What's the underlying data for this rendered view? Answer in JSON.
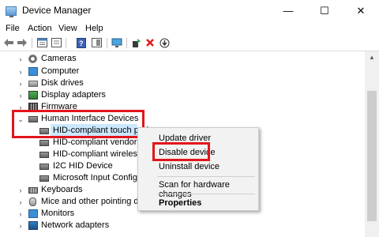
{
  "window": {
    "title": "Device Manager",
    "controls": {
      "minimize": "—",
      "maximize": "☐",
      "close": "✕"
    }
  },
  "menu": [
    "File",
    "Action",
    "View",
    "Help"
  ],
  "toolbar": {
    "icons": [
      "back-icon",
      "forward-icon",
      "properties-icon",
      "help-icon",
      "view-icon",
      "scan-icon",
      "update-driver-icon",
      "uninstall-icon",
      "download-icon"
    ]
  },
  "tree": {
    "rows": [
      {
        "label": "Cameras",
        "expander": "›",
        "icon": "camera-icon"
      },
      {
        "label": "Computer",
        "expander": "›",
        "icon": "computer-icon"
      },
      {
        "label": "Disk drives",
        "expander": "›",
        "icon": "disk-icon"
      },
      {
        "label": "Display adapters",
        "expander": "›",
        "icon": "display-adapter-icon"
      },
      {
        "label": "Firmware",
        "expander": "›",
        "icon": "firmware-icon"
      },
      {
        "label": "Human Interface Devices",
        "expander": "⌄",
        "icon": "hid-icon"
      },
      {
        "label": "HID-compliant touch pad",
        "expander": "",
        "icon": "hid-device-icon",
        "selected": true
      },
      {
        "label": "HID-compliant vendor-de",
        "expander": "",
        "icon": "hid-device-icon"
      },
      {
        "label": "HID-compliant wireless ra",
        "expander": "",
        "icon": "hid-device-icon"
      },
      {
        "label": "I2C HID Device",
        "expander": "",
        "icon": "hid-device-icon"
      },
      {
        "label": "Microsoft Input Configu",
        "expander": "",
        "icon": "hid-device-icon"
      },
      {
        "label": "Keyboards",
        "expander": "›",
        "icon": "keyboard-icon"
      },
      {
        "label": "Mice and other pointing dev",
        "expander": "›",
        "icon": "mouse-icon"
      },
      {
        "label": "Monitors",
        "expander": "›",
        "icon": "monitor-icon"
      },
      {
        "label": "Network adapters",
        "expander": "›",
        "icon": "network-icon"
      }
    ]
  },
  "context_menu": {
    "items": [
      "Update driver",
      "Disable device",
      "Uninstall device",
      "Scan for hardware changes",
      "Properties"
    ]
  },
  "colors": {
    "highlight": "#e2151b",
    "selection": "#cce8ff",
    "menu_bg": "#f2f2f2"
  }
}
